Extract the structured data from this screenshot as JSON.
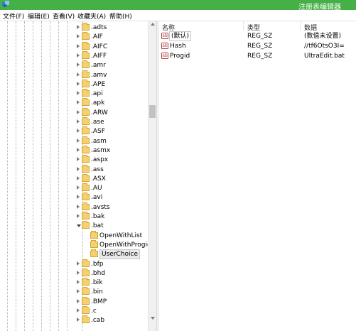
{
  "window": {
    "title": "注册表编辑器"
  },
  "menu": [
    "文件(F)",
    "编辑(E)",
    "查看(V)",
    "收藏夹(A)",
    "帮助(H)"
  ],
  "tree": {
    "items": [
      ".adts",
      ".AIF",
      ".AIFC",
      ".AIFF",
      ".amr",
      ".amv",
      ".APE",
      ".api",
      ".apk",
      ".ARW",
      ".ase",
      ".ASF",
      ".asm",
      ".asmx",
      ".aspx",
      ".ass",
      ".ASX",
      ".AU",
      ".avi",
      ".avsts",
      ".bak",
      ".bat"
    ],
    "bat_children": [
      "OpenWithList",
      "OpenWithProgid",
      "UserChoice"
    ],
    "after_items": [
      ".bfp",
      ".bhd",
      ".bik",
      ".bin",
      ".BMP",
      ".c",
      ".cab"
    ],
    "selected": "UserChoice"
  },
  "list": {
    "columns": {
      "name": "名称",
      "type": "类型",
      "data": "数据"
    },
    "rows": [
      {
        "icon": "string-value-icon",
        "name": "(默认)",
        "type": "REG_SZ",
        "data": "(数值未设置)"
      },
      {
        "icon": "string-value-icon",
        "name": "Hash",
        "type": "REG_SZ",
        "data": "//tf6OtsO3I="
      },
      {
        "icon": "string-value-icon",
        "name": "Progid",
        "type": "REG_SZ",
        "data": "UltraEdit.bat"
      }
    ]
  },
  "colors": {
    "titlebar": "#45b045",
    "folder": "#f4d06f",
    "value_icon": "#b34646"
  }
}
